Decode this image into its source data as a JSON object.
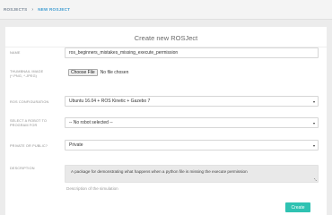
{
  "breadcrumb": {
    "parent": "ROSJECTS",
    "separator": "›",
    "current": "NEW ROSJECT"
  },
  "form": {
    "title": "Create new ROSJect",
    "name": {
      "label": "NAME",
      "value": "ros_beginners_mistakes_missing_execute_permission"
    },
    "thumbnail": {
      "label": "THUMBNAIL IMAGE (*.PNG, *.JPEG)",
      "button_label": "Choose File",
      "status": "No file chosen"
    },
    "ros_configuration": {
      "label": "ROS CONFIGURATION",
      "selected": "Ubuntu 16.04 + ROS Kinetic + Gazebo 7"
    },
    "robot": {
      "label": "SELECT A ROBOT TO PROGRAM FOR",
      "selected": "-- No robot selected --"
    },
    "visibility": {
      "label": "PRIVATE OR PUBLIC?",
      "selected": "Private"
    },
    "description": {
      "label": "DESCRIPTION",
      "value": "A package for demonstrating what happens when a python file is missing the execute permission",
      "help": "Description of the simulation"
    },
    "create_label": "Create"
  },
  "colors": {
    "accent": "#2fc2b2",
    "breadcrumb_active": "#3d9bd1"
  },
  "icons": {
    "dropdown": "caret-down-icon",
    "resize": "resize-handle-icon"
  }
}
